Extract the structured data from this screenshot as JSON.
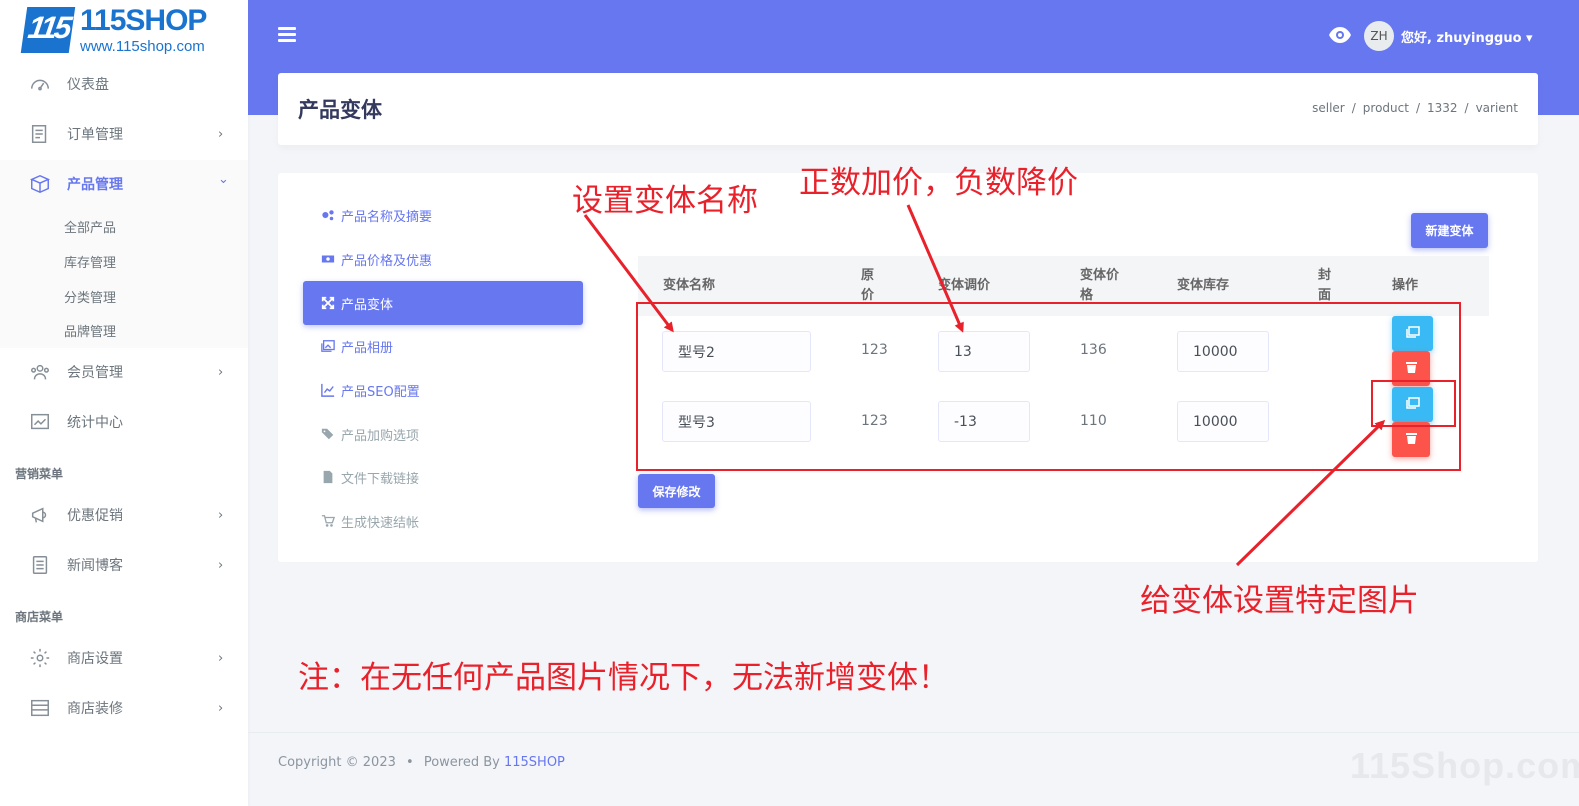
{
  "logo": {
    "name": "115SHOP",
    "url": "www.115shop.com",
    "mark": "115"
  },
  "sidebar": {
    "items": [
      {
        "label": "仪表盘",
        "icon": "dashboard-icon"
      },
      {
        "label": "订单管理",
        "icon": "order-icon"
      },
      {
        "label": "产品管理",
        "icon": "product-box-icon"
      },
      {
        "label": "会员管理",
        "icon": "users-icon"
      },
      {
        "label": "统计中心",
        "icon": "stats-icon"
      },
      {
        "label": "优惠促销",
        "icon": "megaphone-icon"
      },
      {
        "label": "新闻博客",
        "icon": "news-icon"
      },
      {
        "label": "商店设置",
        "icon": "gear-icon"
      },
      {
        "label": "商店装修",
        "icon": "layout-icon"
      }
    ],
    "sub_items": [
      "全部产品",
      "库存管理",
      "分类管理",
      "品牌管理"
    ],
    "headers": [
      "营销菜单",
      "商店菜单"
    ],
    "chevron_right": "›",
    "chevron_down": "⌄"
  },
  "topbar": {
    "avatar": "ZH",
    "user": "您好, zhuyingguo ▾"
  },
  "header": {
    "title": "产品变体",
    "breadcrumb": [
      "seller",
      "product",
      "1332",
      "varient"
    ]
  },
  "subnav": [
    {
      "label": "产品名称及摘要"
    },
    {
      "label": "产品价格及优惠"
    },
    {
      "label": "产品变体"
    },
    {
      "label": "产品相册"
    },
    {
      "label": "产品SEO配置"
    },
    {
      "label": "产品加购选项"
    },
    {
      "label": "文件下载链接"
    },
    {
      "label": "生成快速结帐"
    }
  ],
  "table": {
    "new_button": "新建变体",
    "save_button": "保存修改",
    "headers": [
      "变体名称",
      "原\n价",
      "变体调价",
      "变体价\n格",
      "变体库存",
      "封\n面",
      "操作"
    ],
    "rows": [
      {
        "name": "型号2",
        "original": "123",
        "adjust": "13",
        "price": "136",
        "stock": "10000"
      },
      {
        "name": "型号3",
        "original": "123",
        "adjust": "-13",
        "price": "110",
        "stock": "10000"
      }
    ]
  },
  "annotations": {
    "name": "设置变体名称",
    "price": "正数加价，负数降价",
    "image": "给变体设置特定图片",
    "note": "注：在无任何产品图片情况下，无法新增变体！",
    "color": "#e8212b"
  },
  "footer": {
    "copyright": "Copyright © 2023",
    "dot": "•",
    "powered": "Powered By",
    "brand": "115SHOP"
  },
  "watermark": "115Shop.com",
  "colors": {
    "primary": "#6777ef",
    "info": "#3abaf4",
    "danger": "#fc544b"
  }
}
